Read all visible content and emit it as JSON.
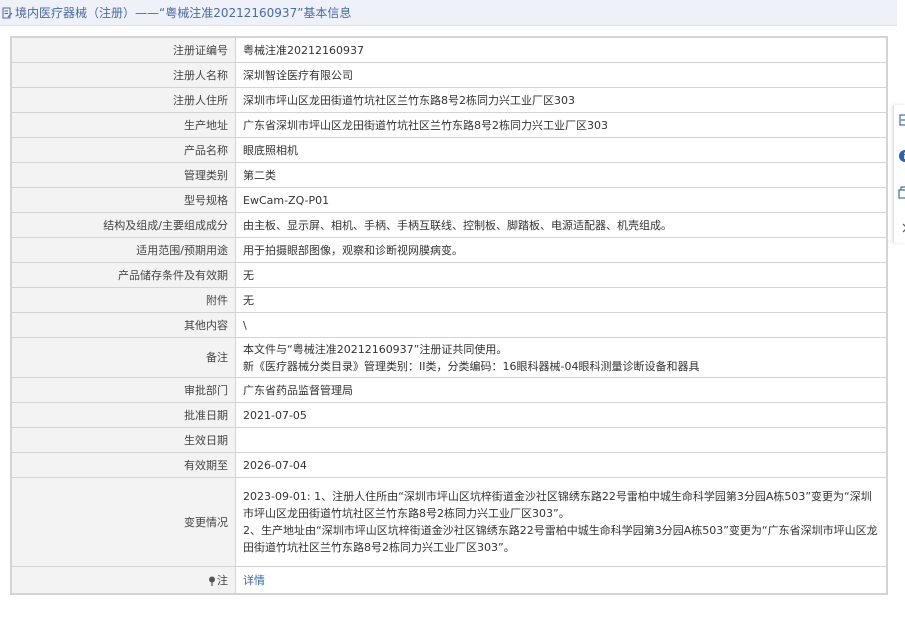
{
  "header": {
    "title": "境内医疗器械（注册）——“粤械注准20212160937”基本信息"
  },
  "rows": {
    "reg_no": {
      "label": "注册证编号",
      "value": "粤械注准20212160937"
    },
    "registrant": {
      "label": "注册人名称",
      "value": "深圳智诠医疗有限公司"
    },
    "registrant_address": {
      "label": "注册人住所",
      "value": "深圳市坪山区龙田街道竹坑社区兰竹东路8号2栋同力兴工业厂区303"
    },
    "production_address": {
      "label": "生产地址",
      "value": "广东省深圳市坪山区龙田街道竹坑社区兰竹东路8号2栋同力兴工业厂区303"
    },
    "product_name": {
      "label": "产品名称",
      "value": "眼底照相机"
    },
    "management_class": {
      "label": "管理类别",
      "value": "第二类"
    },
    "model": {
      "label": "型号规格",
      "value": "EwCam-ZQ-P01"
    },
    "composition": {
      "label": "结构及组成/主要组成成分",
      "value": "由主板、显示屏、相机、手柄、手柄互联线、控制板、脚踏板、电源适配器、机壳组成。"
    },
    "scope": {
      "label": "适用范围/预期用途",
      "value": "用于拍摄眼部图像，观察和诊断视网膜病变。"
    },
    "storage": {
      "label": "产品储存条件及有效期",
      "value": "无"
    },
    "attachment": {
      "label": "附件",
      "value": "无"
    },
    "other": {
      "label": "其他内容",
      "value": "\\"
    },
    "remark": {
      "label": "备注",
      "line1": "本文件与“粤械注准20212160937”注册证共同使用。",
      "line2": "新《医疗器械分类目录》管理类别：II类，分类编码：16眼科器械-04眼科测量诊断设备和器具"
    },
    "authority": {
      "label": "审批部门",
      "value": "广东省药品监督管理局"
    },
    "approval_date": {
      "label": "批准日期",
      "value": "2021-07-05"
    },
    "effective_date": {
      "label": "生效日期",
      "value": ""
    },
    "expiry_date": {
      "label": "有效期至",
      "value": "2026-07-04"
    },
    "change": {
      "label": "变更情况",
      "text1": "2023-09-01: 1、注册人住所由“深圳市坪山区坑梓街道金沙社区锦绣东路22号雷柏中城生命科学园第3分园A栋503”变更为“深圳市坪山区龙田街道竹坑社区兰竹东路8号2栋同力兴工业厂区303”。",
      "text2": "2、生产地址由“深圳市坪山区坑梓街道金沙社区锦绣东路22号雷柏中城生命科学园第3分园A栋503”变更为“广东省深圳市坪山区龙田街道竹坑社区兰竹东路8号2栋同力兴工业厂区303”。"
    },
    "note": {
      "label": "注",
      "link": "详情"
    }
  },
  "icons": {
    "title": "document-edit-icon",
    "note": "pin-icon",
    "side": [
      "export-icon",
      "info-icon",
      "copy-icon",
      "chevron-right-icon"
    ]
  },
  "colors": {
    "title_text": "#4a6aa8",
    "label_bg": "#f3f3f3",
    "link": "#2f6db5",
    "border": "#d4d4d4"
  }
}
